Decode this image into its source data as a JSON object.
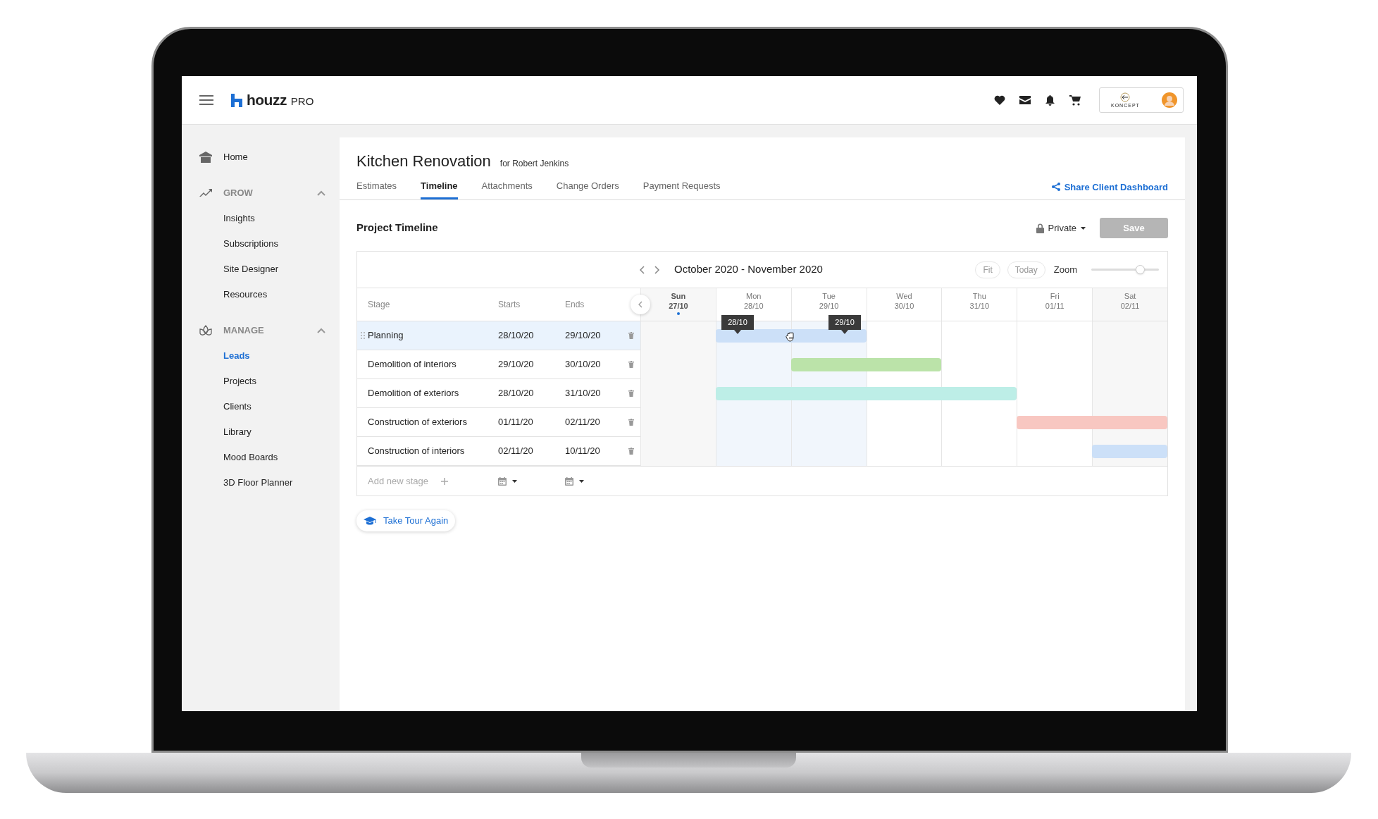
{
  "app": {
    "logo_text": "houzz",
    "logo_suffix": "PRO"
  },
  "account": {
    "company": "KONCEPT"
  },
  "sidebar": [
    {
      "kind": "link",
      "label": "Home",
      "selected": false
    },
    {
      "kind": "group",
      "label": "GROW",
      "expanded": true,
      "items": [
        {
          "label": "Insights",
          "selected": false
        },
        {
          "label": "Subscriptions",
          "selected": false
        },
        {
          "label": "Site Designer",
          "selected": false
        },
        {
          "label": "Resources",
          "selected": false
        }
      ]
    },
    {
      "kind": "group",
      "label": "MANAGE",
      "expanded": true,
      "items": [
        {
          "label": "Leads",
          "selected": true
        },
        {
          "label": "Projects",
          "selected": false
        },
        {
          "label": "Clients",
          "selected": false
        },
        {
          "label": "Library",
          "selected": false
        },
        {
          "label": "Mood Boards",
          "selected": false
        },
        {
          "label": "3D Floor Planner",
          "selected": false
        }
      ]
    }
  ],
  "project": {
    "title": "Kitchen Renovation",
    "client": "for Robert Jenkins"
  },
  "tabs": [
    {
      "label": "Estimates",
      "selected": false
    },
    {
      "label": "Timeline",
      "selected": true
    },
    {
      "label": "Attachments",
      "selected": false
    },
    {
      "label": "Change Orders",
      "selected": false
    },
    {
      "label": "Payment Requests",
      "selected": false
    }
  ],
  "share_link": "Share Client Dashboard",
  "section": {
    "title": "Project Timeline",
    "visibility": "Private",
    "save": {
      "label": "Save",
      "disabled": true
    }
  },
  "timeline": {
    "range": "October 2020 - November 2020",
    "fit": "Fit",
    "today": "Today",
    "zoom_label": "Zoom",
    "zoom": {
      "level": 0.72
    },
    "columns": [
      "Stage",
      "Starts",
      "Ends"
    ],
    "days": [
      {
        "day": "Sun",
        "date": "27/10",
        "today": true,
        "weekend": true
      },
      {
        "day": "Mon",
        "date": "28/10",
        "today": false,
        "weekend": false
      },
      {
        "day": "Tue",
        "date": "29/10",
        "today": false,
        "weekend": false
      },
      {
        "day": "Wed",
        "date": "30/10",
        "today": false,
        "weekend": false
      },
      {
        "day": "Thu",
        "date": "31/10",
        "today": false,
        "weekend": false
      },
      {
        "day": "Fri",
        "date": "01/11",
        "today": false,
        "weekend": false
      },
      {
        "day": "Sat",
        "date": "02/11",
        "today": false,
        "weekend": true
      }
    ],
    "stages": [
      {
        "stage": "Planning",
        "starts": "28/10/20",
        "ends": "29/10/20",
        "selected": true,
        "color": "#cce0f8"
      },
      {
        "stage": "Demolition of interiors",
        "starts": "29/10/20",
        "ends": "30/10/20",
        "selected": false,
        "color": "#bbe3a9"
      },
      {
        "stage": "Demolition of exteriors",
        "starts": "28/10/20",
        "ends": "31/10/20",
        "selected": false,
        "color": "#bdeee7"
      },
      {
        "stage": "Construction of exteriors",
        "starts": "01/11/20",
        "ends": "02/11/20",
        "selected": false,
        "color": "#f8c7c1"
      },
      {
        "stage": "Construction of interiors",
        "starts": "02/11/20",
        "ends": "10/11/20",
        "selected": false,
        "color": "#cce0f8"
      }
    ],
    "drag_tooltips": [
      "28/10",
      "29/10"
    ],
    "add_placeholder": "Add new stage"
  },
  "tour_button": "Take Tour Again"
}
